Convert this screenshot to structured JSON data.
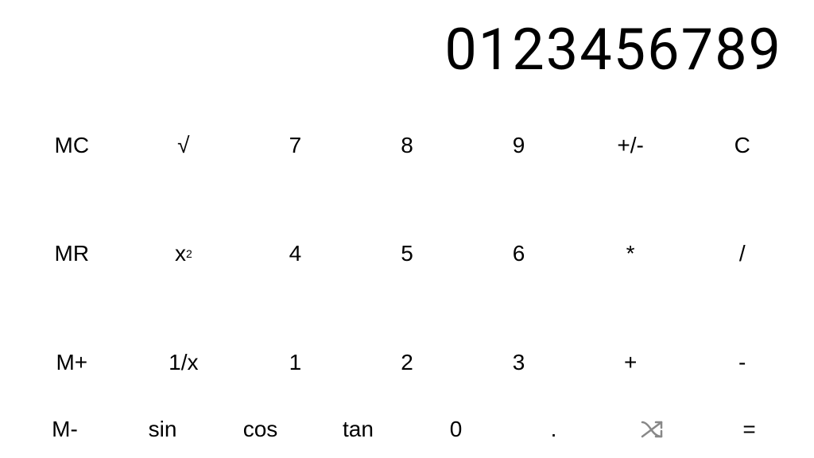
{
  "display": {
    "value": "0123456789"
  },
  "buttons": [
    [
      {
        "label": "MC",
        "name": "mc-button",
        "class": ""
      },
      {
        "label": "√",
        "name": "sqrt-button",
        "class": ""
      },
      {
        "label": "7",
        "name": "seven-button",
        "class": ""
      },
      {
        "label": "8",
        "name": "eight-button",
        "class": ""
      },
      {
        "label": "9",
        "name": "nine-button",
        "class": ""
      },
      {
        "label": "+/-",
        "name": "plusminus-button",
        "class": ""
      },
      {
        "label": "C",
        "name": "clear-button",
        "class": ""
      }
    ],
    [
      {
        "label": "MR",
        "name": "mr-button",
        "class": ""
      },
      {
        "label": "x²",
        "name": "square-button",
        "class": "btn-superscript"
      },
      {
        "label": "4",
        "name": "four-button",
        "class": ""
      },
      {
        "label": "5",
        "name": "five-button",
        "class": ""
      },
      {
        "label": "6",
        "name": "six-button",
        "class": ""
      },
      {
        "label": "*",
        "name": "multiply-button",
        "class": ""
      },
      {
        "label": "/",
        "name": "divide-button",
        "class": ""
      }
    ],
    [
      {
        "label": "M+",
        "name": "mplus-button",
        "class": ""
      },
      {
        "label": "1/x",
        "name": "reciprocal-button",
        "class": ""
      },
      {
        "label": "1",
        "name": "one-button",
        "class": ""
      },
      {
        "label": "2",
        "name": "two-button",
        "class": ""
      },
      {
        "label": "3",
        "name": "three-button",
        "class": ""
      },
      {
        "label": "+",
        "name": "plus-button",
        "class": ""
      },
      {
        "label": "-",
        "name": "minus-button",
        "class": ""
      }
    ],
    [
      {
        "label": "M-",
        "name": "mminus-button",
        "class": ""
      },
      {
        "label": "sin",
        "name": "sin-button",
        "class": ""
      },
      {
        "label": "cos",
        "name": "cos-button",
        "class": ""
      },
      {
        "label": "tan",
        "name": "tan-button",
        "class": ""
      },
      {
        "label": "0",
        "name": "zero-button",
        "class": ""
      },
      {
        "label": ".",
        "name": "decimal-button",
        "class": ""
      },
      {
        "label": "⇌",
        "name": "shuffle-button",
        "class": "btn-gray"
      },
      {
        "label": "=",
        "name": "equals-button",
        "class": ""
      }
    ]
  ]
}
